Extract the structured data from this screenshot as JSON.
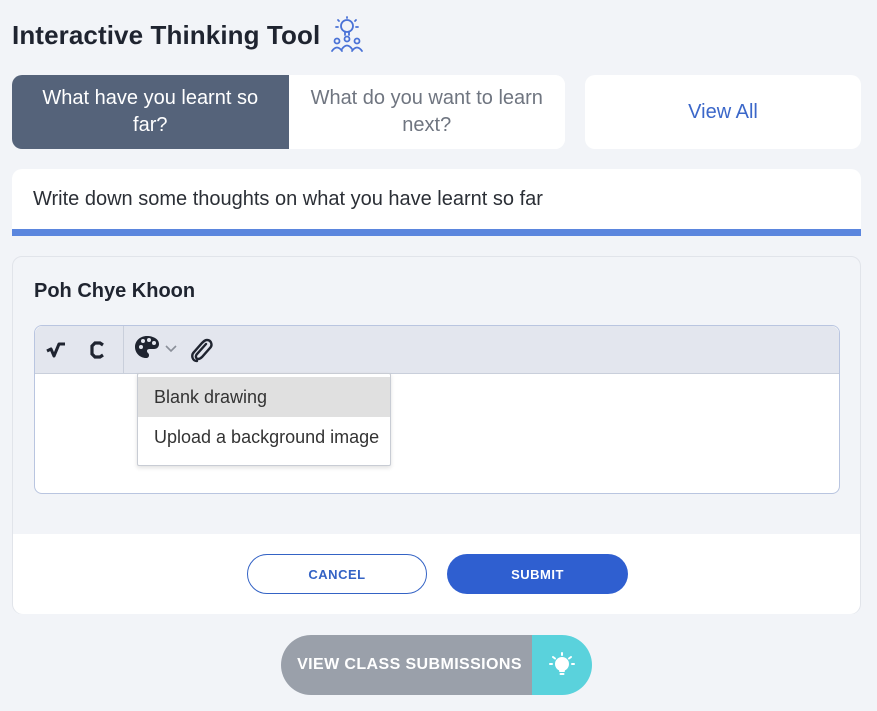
{
  "header": {
    "title": "Interactive Thinking Tool",
    "icon": "lightbulb-people-icon"
  },
  "tabs": [
    {
      "label": "What have you learnt so far?",
      "active": true
    },
    {
      "label": "What do you want to learn next?",
      "active": false
    }
  ],
  "view_all_label": "View All",
  "prompt_text": "Write down some thoughts on what you have learnt so far",
  "card": {
    "student_name": "Poh Chye Khoon",
    "toolbar": {
      "icons": [
        "math-sqrt-icon",
        "chemistry-icon",
        "palette-icon",
        "chevron-down-icon",
        "paperclip-icon"
      ]
    },
    "dropdown": {
      "items": [
        {
          "label": "Blank drawing",
          "highlighted": true
        },
        {
          "label": "Upload a background image",
          "highlighted": false
        }
      ]
    },
    "cancel_label": "CANCEL",
    "submit_label": "SUBMIT"
  },
  "view_class_label": "VIEW CLASS SUBMISSIONS",
  "colors": {
    "accent": "#2f5fd0",
    "active_tab": "#55637a",
    "prompt_underline": "#5b86de",
    "bulb_bg": "#5ad2dc"
  }
}
